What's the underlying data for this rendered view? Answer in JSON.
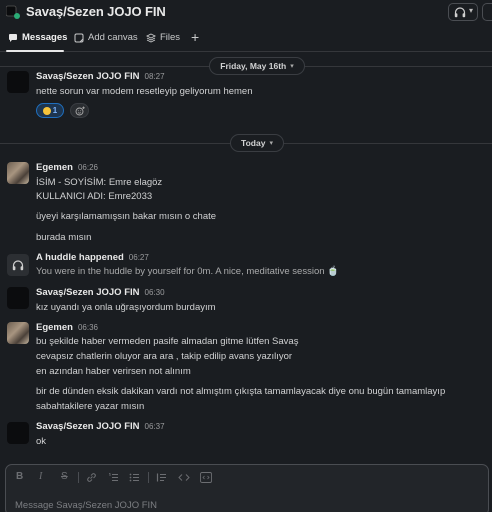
{
  "header": {
    "channel_title": "Savaş/Sezen JOJO FIN"
  },
  "tabs": [
    {
      "label": "Messages"
    },
    {
      "label": "Add canvas"
    },
    {
      "label": "Files"
    }
  ],
  "dividers": {
    "first_date": "Friday, May 16th",
    "second_date": "Today"
  },
  "messages": [
    {
      "sender": "Savaş/Sezen JOJO FIN",
      "time": "08:27",
      "lines": [
        "nette sorun var modem resetleyip geliyorum hemen"
      ],
      "reaction": {
        "count": "1",
        "emoji_icon": "smile-emoji"
      }
    },
    {
      "sender": "Egemen",
      "time": "06:26",
      "lines": [
        "İSİM - SOYİSİM: Emre elagöz",
        "KULLANICI ADI: Emre2033",
        "üyeyi karşılamamışsın bakar mısın o chate",
        "burada  mısın"
      ]
    },
    {
      "sender": "A huddle happened",
      "time": "06:27",
      "lines": [
        "You were in the huddle by yourself for 0m. A nice, meditative session 🍵"
      ]
    },
    {
      "sender": "Savaş/Sezen JOJO FIN",
      "time": "06:30",
      "lines": [
        "kız uyandı ya onla uğraşıyordum burdayım"
      ]
    },
    {
      "sender": "Egemen",
      "time": "06:36",
      "lines": [
        "bu şekilde haber vermeden pasife almadan gitme lütfen Savaş",
        "cevapsız chatlerin oluyor ara ara , takip edilip avans yazılıyor",
        " en azından haber verirsen not alınım",
        "bir de dünden eksik dakikan vardı not almıştım çıkışta tamamlayacak diye onu bugün tamamlayıp",
        "sabahtakilere yazar mısın"
      ]
    },
    {
      "sender": "Savaş/Sezen JOJO FIN",
      "time": "06:37",
      "lines": [
        "ok"
      ]
    }
  ],
  "composer": {
    "placeholder": "Message Savaş/Sezen JOJO FIN",
    "bold": "B",
    "italic": "I",
    "strike": "S"
  },
  "colors": {
    "accent": "#1f6fbf",
    "background": "#1a1d21",
    "text": "#d1d2d3"
  }
}
